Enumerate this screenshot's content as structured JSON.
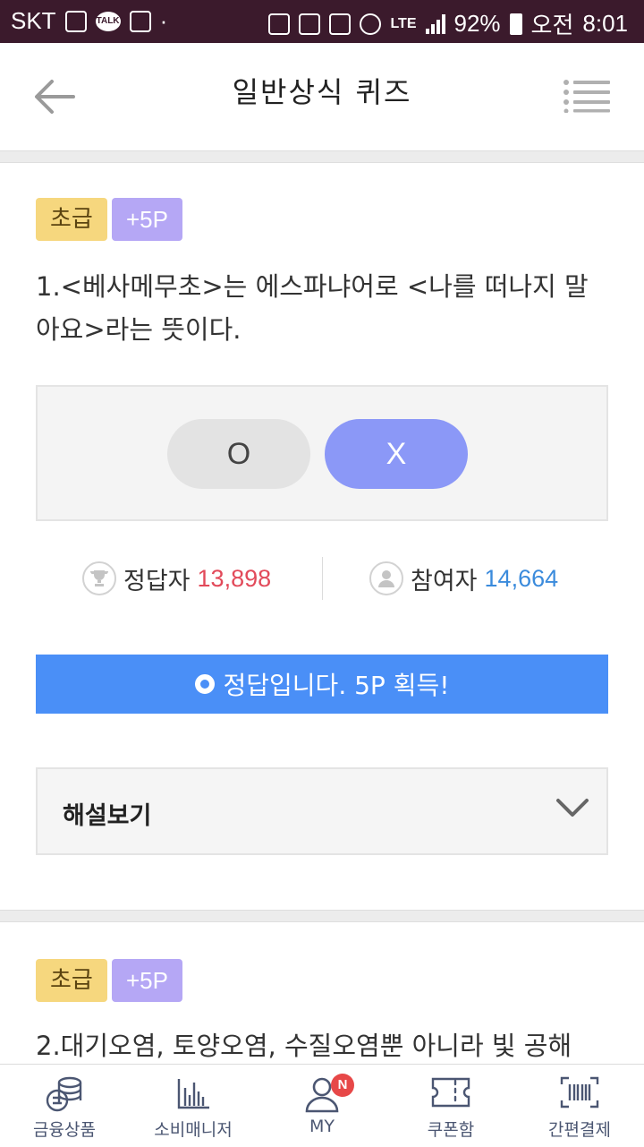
{
  "status_bar": {
    "carrier": "SKT",
    "talk_icon_text": "TALK",
    "network": "LTE",
    "battery": "92%",
    "ampm": "오전",
    "time": "8:01"
  },
  "header": {
    "title": "일반상식 퀴즈"
  },
  "quiz1": {
    "level": "초급",
    "points": "+5P",
    "question": "1.<베사메무초>는 에스파냐어로 <나를 떠나지 말아요>라는 뜻이다.",
    "option_o": "O",
    "option_x": "X",
    "correct_label": "정답자",
    "correct_count": "13,898",
    "participant_label": "참여자",
    "participant_count": "14,664",
    "result": "정답입니다. 5P 획득!",
    "explanation_label": "해설보기"
  },
  "quiz2": {
    "level": "초급",
    "points": "+5P",
    "question": "2.대기오염, 토양오염, 수질오염뿐 아니라 빛 공해"
  },
  "tabbar": {
    "items": [
      {
        "label": "금융상품",
        "icon": "coins-icon"
      },
      {
        "label": "소비매니저",
        "icon": "bar-chart-icon"
      },
      {
        "label": "MY",
        "icon": "person-icon",
        "badge": "N"
      },
      {
        "label": "쿠폰함",
        "icon": "ticket-icon"
      },
      {
        "label": "간편결제",
        "icon": "barcode-icon"
      }
    ]
  },
  "colors": {
    "status_bar": "#3b1a2c",
    "level_badge": "#f6d77e",
    "point_badge": "#b5a7f5",
    "x_selected": "#8b98f7",
    "result_bar": "#4a8ff7",
    "correct_count": "#e24a5a",
    "participant_count": "#3b8bdc"
  }
}
